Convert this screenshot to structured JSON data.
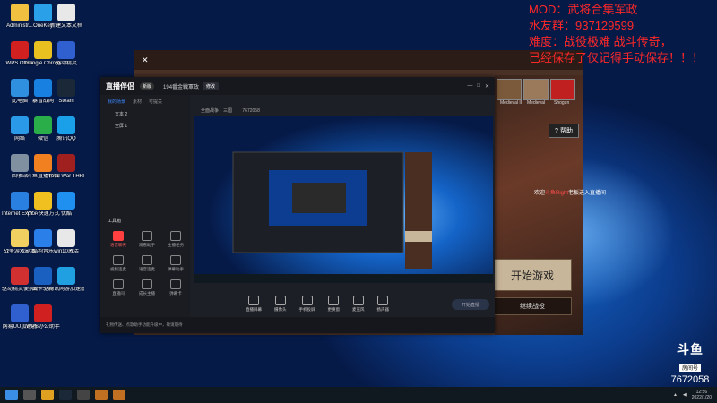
{
  "desktop": {
    "icons": [
      {
        "label": "Administr...",
        "color": "#f0c040"
      },
      {
        "label": "OneKey",
        "color": "#2aa0e8"
      },
      {
        "label": "新建文本文档",
        "color": "#e8e8e8"
      },
      {
        "label": "WPS Office",
        "color": "#d02020"
      },
      {
        "label": "Google Chrome",
        "color": "#e8c020"
      },
      {
        "label": "驱动精灵",
        "color": "#3060d0"
      },
      {
        "label": "此电脑",
        "color": "#3090e0"
      },
      {
        "label": "暴雪战网",
        "color": "#1880e0"
      },
      {
        "label": "Steam",
        "color": "#1b2838"
      },
      {
        "label": "网络",
        "color": "#2a9ae8"
      },
      {
        "label": "微信",
        "color": "#2aae4a"
      },
      {
        "label": "腾讯QQ",
        "color": "#1aa0e8"
      },
      {
        "label": "回收站",
        "color": "#8090a0"
      },
      {
        "label": "斗鱼直播伴侣",
        "color": "#f08020"
      },
      {
        "label": "Total War THREE KI...",
        "color": "#a02020"
      },
      {
        "label": "Internet Explorer",
        "color": "#2a80e0"
      },
      {
        "label": "YY - 快速方式",
        "color": "#f0c020"
      },
      {
        "label": "优酷",
        "color": "#2090f0"
      },
      {
        "label": "战争游戏副本",
        "color": "#f0d060"
      },
      {
        "label": "酷狗音乐",
        "color": "#2a80e8"
      },
      {
        "label": "win10激活",
        "color": "#e8e8e8"
      },
      {
        "label": "驱动精灵便携版",
        "color": "#d03030"
      },
      {
        "label": "显卡驱动",
        "color": "#1a60c0"
      },
      {
        "label": "腾讯网游加速器",
        "color": "#20a0e0"
      },
      {
        "label": "网易UU加速器",
        "color": "#3060d0"
      },
      {
        "label": "WPS办公助手",
        "color": "#d02020"
      }
    ]
  },
  "overlay": {
    "line1": "MOD：武将合集军政",
    "line2": "水友群：937129599",
    "line3": "难度：战役极难 战斗传奇，",
    "line4": "已经保存了仅记得手动保存！！！"
  },
  "game": {
    "thumbs": [
      {
        "label": "",
        "color": "#8a6040"
      },
      {
        "label": "Medieval II",
        "color": "#7a5a3a"
      },
      {
        "label": "Medieval",
        "color": "#9a7a5a"
      },
      {
        "label": "Shogun",
        "color": "#c02020"
      }
    ],
    "help_label": "帮助",
    "start_label": "开始游戏",
    "continue_label": "继续战役",
    "chat_prefix": "欢迎",
    "chat_user": "斗鱼Right",
    "chat_suffix": "老板进入直播间"
  },
  "app": {
    "logo": "直播伴侣",
    "version": "新版",
    "room_title": "194番金戦軍政",
    "title_tag": "修改",
    "category": "全面战争：三国",
    "room_id": "7672058",
    "tabs": [
      {
        "label": "我的场景",
        "active": true
      },
      {
        "label": "素材",
        "active": false
      },
      {
        "label": "可提关",
        "active": false
      }
    ],
    "scenes": [
      "文本 2",
      "全屏 1"
    ],
    "tools_header": "工具箱",
    "tools": [
      {
        "label": "语音聊天",
        "red": true
      },
      {
        "label": "观看助手",
        "red": false
      },
      {
        "label": "主播任务",
        "red": false
      },
      {
        "label": "视频连麦",
        "red": false
      },
      {
        "label": "语音连麦",
        "red": false
      },
      {
        "label": "弹幕助手",
        "red": false
      },
      {
        "label": "直播间",
        "red": false
      },
      {
        "label": "成长主播",
        "red": false
      },
      {
        "label": "弹幕卡",
        "red": false
      }
    ],
    "controls": [
      "直播屏幕",
      "摄像头",
      "手机投屏",
      "更换窗",
      "麦克风",
      "扬声器"
    ],
    "go_live": "开始直播",
    "status_text": "礼物传送、点歌助手功能升级中，敬请期待"
  },
  "watermark": {
    "brand": "斗鱼",
    "sub": "房间号",
    "room": "7672058"
  },
  "clock": {
    "time": "12:56",
    "date": "2022/1/20"
  }
}
